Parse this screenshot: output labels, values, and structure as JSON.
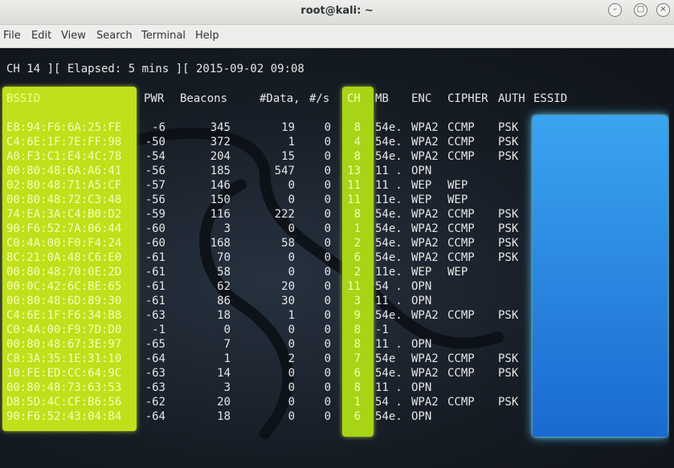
{
  "window": {
    "title": "root@kali: ~"
  },
  "menubar": [
    "File",
    "Edit",
    "View",
    "Search",
    "Terminal",
    "Help"
  ],
  "status_line": "CH 14 ][ Elapsed: 5 mins ][ 2015-09-02 09:08",
  "headers": {
    "bssid": "BSSID",
    "pwr": "PWR",
    "beacons": "Beacons",
    "data": "#Data,",
    "s": "#/s",
    "ch": "CH",
    "mb": "MB",
    "enc": "ENC",
    "cipher": "CIPHER",
    "auth": "AUTH",
    "essid": "ESSID"
  },
  "rows": [
    [
      "E8:94:F6:6A:25:FE",
      "-6",
      "345",
      "19",
      "0",
      "8",
      "54e.",
      "WPA2",
      "CCMP",
      "PSK"
    ],
    [
      "C4:6E:1F:7E:FF:98",
      "-50",
      "372",
      "1",
      "0",
      "4",
      "54e.",
      "WPA2",
      "CCMP",
      "PSK"
    ],
    [
      "A0:F3:C1:E4:4C:78",
      "-54",
      "204",
      "15",
      "0",
      "8",
      "54e.",
      "WPA2",
      "CCMP",
      "PSK"
    ],
    [
      "00:80:48:6A:A6:41",
      "-56",
      "185",
      "547",
      "0",
      "13",
      "11 .",
      "OPN",
      "",
      ""
    ],
    [
      "02:80:48:71:A5:CF",
      "-57",
      "146",
      "0",
      "0",
      "11",
      "11 .",
      "WEP",
      "WEP",
      ""
    ],
    [
      "00:80:48:72:C3:48",
      "-56",
      "150",
      "0",
      "0",
      "11",
      "11e.",
      "WEP",
      "WEP",
      ""
    ],
    [
      "74:EA:3A:C4:B0:D2",
      "-59",
      "116",
      "222",
      "0",
      "8",
      "54e.",
      "WPA2",
      "CCMP",
      "PSK"
    ],
    [
      "90:F6:52:7A:06:44",
      "-60",
      "3",
      "0",
      "0",
      "1",
      "54e.",
      "WPA2",
      "CCMP",
      "PSK"
    ],
    [
      "C0:4A:00:F0:F4:24",
      "-60",
      "168",
      "58",
      "0",
      "2",
      "54e.",
      "WPA2",
      "CCMP",
      "PSK"
    ],
    [
      "8C:21:0A:48:C6:E0",
      "-61",
      "70",
      "0",
      "0",
      "6",
      "54e.",
      "WPA2",
      "CCMP",
      "PSK"
    ],
    [
      "00:80:48:70:0E:2D",
      "-61",
      "58",
      "0",
      "0",
      "2",
      "11e.",
      "WEP",
      "WEP",
      ""
    ],
    [
      "00:0C:42:6C:BE:65",
      "-61",
      "62",
      "20",
      "0",
      "11",
      "54 .",
      "OPN",
      "",
      ""
    ],
    [
      "00:80:48:6D:89:30",
      "-61",
      "86",
      "30",
      "0",
      "3",
      "11 .",
      "OPN",
      "",
      ""
    ],
    [
      "C4:6E:1F:F6:34:B8",
      "-63",
      "18",
      "1",
      "0",
      "9",
      "54e.",
      "WPA2",
      "CCMP",
      "PSK"
    ],
    [
      "C0:4A:00:F9:7D:D0",
      "-1",
      "0",
      "0",
      "0",
      "8",
      "-1",
      "",
      "",
      ""
    ],
    [
      "00:80:48:67:3E:97",
      "-65",
      "7",
      "0",
      "0",
      "8",
      "11 .",
      "OPN",
      "",
      ""
    ],
    [
      "C8:3A:35:1E:31:10",
      "-64",
      "1",
      "2",
      "0",
      "7",
      "54e",
      "WPA2",
      "CCMP",
      "PSK"
    ],
    [
      "10:FE:ED:CC:64:9C",
      "-63",
      "14",
      "0",
      "0",
      "6",
      "54e.",
      "WPA2",
      "CCMP",
      "PSK"
    ],
    [
      "00:80:48:73:63:53",
      "-63",
      "3",
      "0",
      "0",
      "8",
      "11 .",
      "OPN",
      "",
      ""
    ],
    [
      "D8:5D:4C:CF:B6:56",
      "-62",
      "20",
      "0",
      "0",
      "1",
      "54 .",
      "WPA2",
      "CCMP",
      "PSK"
    ],
    [
      "90:F6:52:43:04:B4",
      "-64",
      "18",
      "0",
      "0",
      "6",
      "54e.",
      "OPN",
      "",
      ""
    ]
  ],
  "colors": {
    "bssid_highlight": "#bfe01a",
    "ch_highlight": "#a8d418",
    "essid_redaction": "#2a86e0"
  }
}
